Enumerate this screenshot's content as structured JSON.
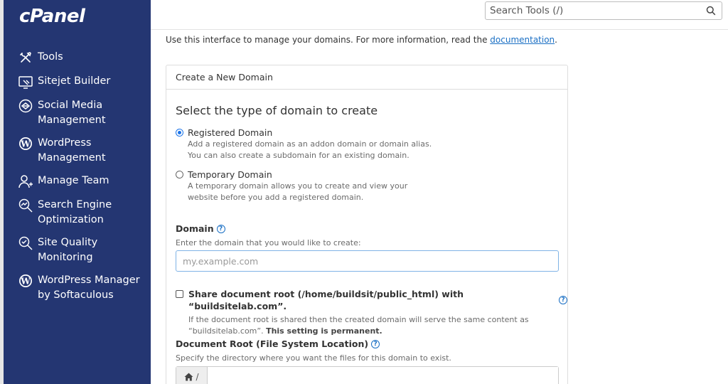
{
  "brand": {
    "logo_text": "cPanel"
  },
  "sidebar": {
    "items": [
      {
        "label": "Tools",
        "icon": "tools-icon"
      },
      {
        "label": "Sitejet Builder",
        "icon": "sitejet-icon"
      },
      {
        "label": "Social Media Management",
        "icon": "social-media-icon"
      },
      {
        "label": "WordPress Management",
        "icon": "wordpress-icon"
      },
      {
        "label": "Manage Team",
        "icon": "team-icon"
      },
      {
        "label": "Search Engine Optimization",
        "icon": "seo-icon"
      },
      {
        "label": "Site Quality Monitoring",
        "icon": "site-quality-icon"
      },
      {
        "label": "WordPress Manager by Softaculous",
        "icon": "wordpress-icon"
      }
    ]
  },
  "search": {
    "placeholder": "Search Tools (/)"
  },
  "intro": {
    "text": "Use this interface to manage your domains. For more information, read the ",
    "link": "documentation",
    "suffix": "."
  },
  "panel": {
    "header": "Create a New Domain",
    "section_title": "Select the type of domain to create",
    "options": [
      {
        "label": "Registered Domain",
        "checked": true,
        "desc1": "Add a registered domain as an addon domain or domain alias.",
        "desc2": "You can also create a subdomain for an existing domain."
      },
      {
        "label": "Temporary Domain",
        "checked": false,
        "desc1": "A temporary domain allows you to create and view your",
        "desc2": "website before you add a registered domain."
      }
    ],
    "domain": {
      "label": "Domain",
      "hint": "Enter the domain that you would like to create:",
      "placeholder": "my.example.com",
      "value": ""
    },
    "share": {
      "label": "Share document root (/home/buildsit/public_html) with “buildsitelab.com”.",
      "desc1": "If the document root is shared then the created domain will serve the same content as",
      "desc2": "“buildsitelab.com”. ",
      "desc2_bold": "This setting is permanent.",
      "checked": false
    },
    "docroot": {
      "label": "Document Root (File System Location)",
      "hint": "Specify the directory where you want the files for this domain to exist.",
      "prefix": "/"
    }
  },
  "colors": {
    "sidebar_bg": "#243672",
    "link": "#1a6fc4",
    "accent": "#1a73e8"
  }
}
